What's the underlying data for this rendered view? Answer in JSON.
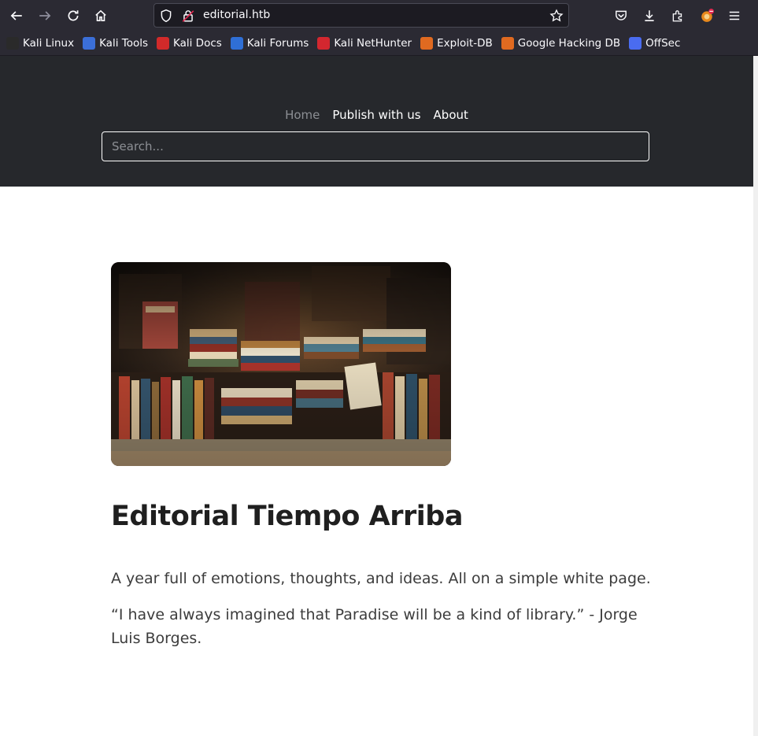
{
  "browser": {
    "url": "editorial.htb",
    "bookmarks": [
      {
        "label": "Kali Linux",
        "icon": "kali-dragon-icon",
        "color": "#2a2a2a"
      },
      {
        "label": "Kali Tools",
        "icon": "kali-tools-icon",
        "color": "#3b6fd8"
      },
      {
        "label": "Kali Docs",
        "icon": "kali-docs-icon",
        "color": "#d22a2a"
      },
      {
        "label": "Kali Forums",
        "icon": "kali-forums-icon",
        "color": "#2f6fd6"
      },
      {
        "label": "Kali NetHunter",
        "icon": "kali-nethunter-icon",
        "color": "#d3272f"
      },
      {
        "label": "Exploit-DB",
        "icon": "exploit-db-icon",
        "color": "#e06a20"
      },
      {
        "label": "Google Hacking DB",
        "icon": "ghdb-icon",
        "color": "#e06a20"
      },
      {
        "label": "OffSec",
        "icon": "offsec-icon",
        "color": "#4a6cf0"
      }
    ]
  },
  "site": {
    "nav": [
      {
        "label": "Home",
        "active": true
      },
      {
        "label": "Publish with us",
        "active": false
      },
      {
        "label": "About",
        "active": false
      }
    ],
    "search": {
      "placeholder": "Search..."
    }
  },
  "main": {
    "title": "Editorial Tiempo Arriba",
    "paragraph1": "A year full of emotions, thoughts, and ideas. All on a simple white page.",
    "paragraph2": "“I have always imagined that Paradise will be a kind of library.” - Jorge Luis Borges."
  },
  "colors": {
    "header_bg": "#26282c",
    "toolbar_bg": "#2b2a33"
  }
}
